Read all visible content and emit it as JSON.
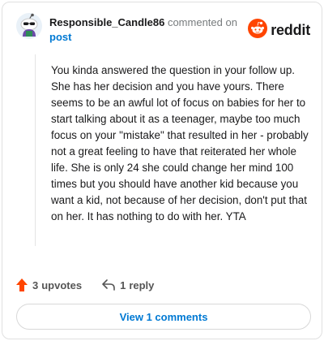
{
  "header": {
    "username": "Responsible_Candle86",
    "action_text": "commented on",
    "post_link": "post",
    "brand": "reddit"
  },
  "comment": {
    "body": "You kinda answered the question in your follow up. She has her decision and you have yours. There seems to be an awful lot of focus on babies for her to start talking about it as a teenager, maybe too much focus on your \"mistake\" that resulted in her - probably not a great feeling to have that reiterated her whole life. She is only 24 she could change her mind 100 times but you should have another kid because you want a kid, not because of her decision, don't put that on her. It has nothing to do with her. YTA"
  },
  "footer": {
    "upvotes_count": "3",
    "upvotes_label": "upvotes",
    "reply_count": "1",
    "reply_label": "reply",
    "view_comments_label": "View 1 comments"
  },
  "colors": {
    "upvote": "#ff4500",
    "link": "#0079d3",
    "reddit_orange": "#ff4500"
  },
  "icons": {
    "avatar": "snoo-avatar-icon",
    "logo": "reddit-snoo-icon",
    "upvote": "upvote-arrow-icon",
    "reply": "reply-arrow-icon"
  }
}
